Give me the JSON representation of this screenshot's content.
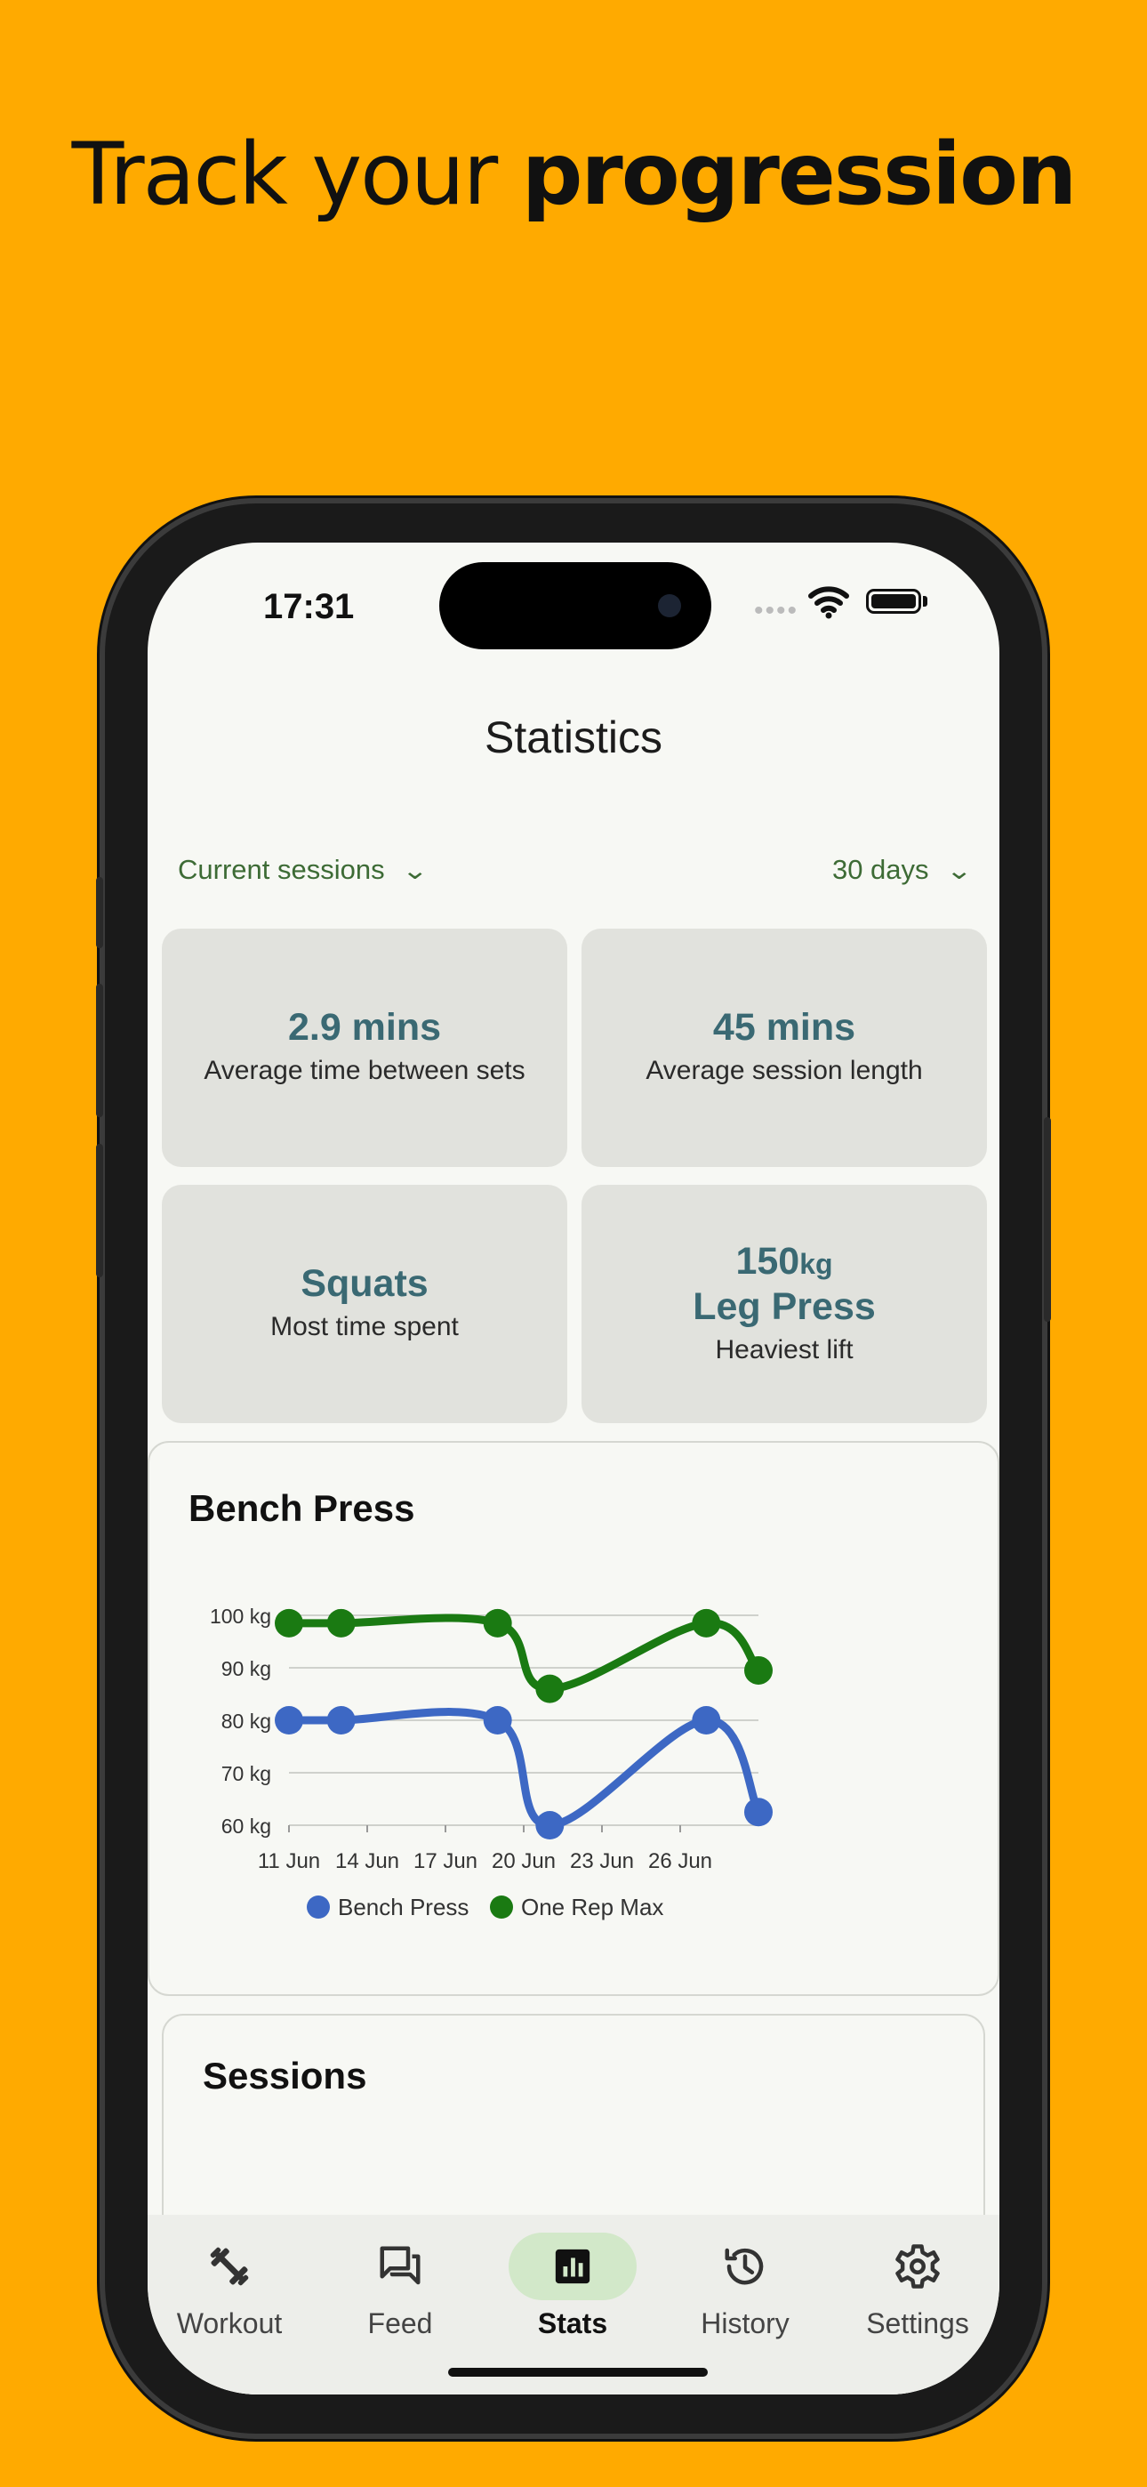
{
  "headline": {
    "plain": "Track your ",
    "bold": "progression"
  },
  "status_bar": {
    "time": "17:31"
  },
  "page": {
    "title": "Statistics"
  },
  "filters": {
    "scope": "Current sessions",
    "range": "30 days"
  },
  "tiles": [
    {
      "value": "2.9 mins",
      "label": "Average time between sets"
    },
    {
      "value": "45 mins",
      "label": "Average session length"
    },
    {
      "value": "Squats",
      "label": "Most time spent"
    },
    {
      "value_number": "150",
      "value_unit": "kg",
      "value_name": "Leg Press",
      "label": "Heaviest lift"
    }
  ],
  "bench_card": {
    "title": "Bench Press"
  },
  "sessions_card": {
    "title": "Sessions"
  },
  "chart_data": {
    "type": "line",
    "title": "Bench Press",
    "x": [
      "2024-06-11",
      "2024-06-13",
      "2024-06-19",
      "2024-06-21",
      "2024-06-27",
      "2024-06-29"
    ],
    "x_ticks": [
      "11 Jun",
      "14 Jun",
      "17 Jun",
      "20 Jun",
      "23 Jun",
      "26 Jun"
    ],
    "y_ticks": [
      "60 kg",
      "70 kg",
      "80 kg",
      "90 kg",
      "100 kg"
    ],
    "ylim": [
      60,
      100
    ],
    "series": [
      {
        "name": "Bench Press",
        "color": "#3D68C4",
        "values": [
          80,
          80,
          80,
          60,
          80,
          62.5
        ]
      },
      {
        "name": "One Rep Max",
        "color": "#1A7A12",
        "values": [
          98.5,
          98.5,
          98.5,
          86,
          98.5,
          89.5
        ]
      }
    ],
    "grid": true,
    "legend": "bottom"
  },
  "nav": {
    "items": [
      {
        "label": "Workout",
        "icon": "dumbbell-icon"
      },
      {
        "label": "Feed",
        "icon": "chat-bubbles-icon"
      },
      {
        "label": "Stats",
        "icon": "bar-chart-icon",
        "active": true
      },
      {
        "label": "History",
        "icon": "history-icon"
      },
      {
        "label": "Settings",
        "icon": "gear-icon"
      }
    ]
  },
  "colors": {
    "background": "#FFAA00",
    "accent_green": "#3d6b35",
    "tile_value": "#3A6973",
    "active_pill": "#D2E8C9"
  }
}
